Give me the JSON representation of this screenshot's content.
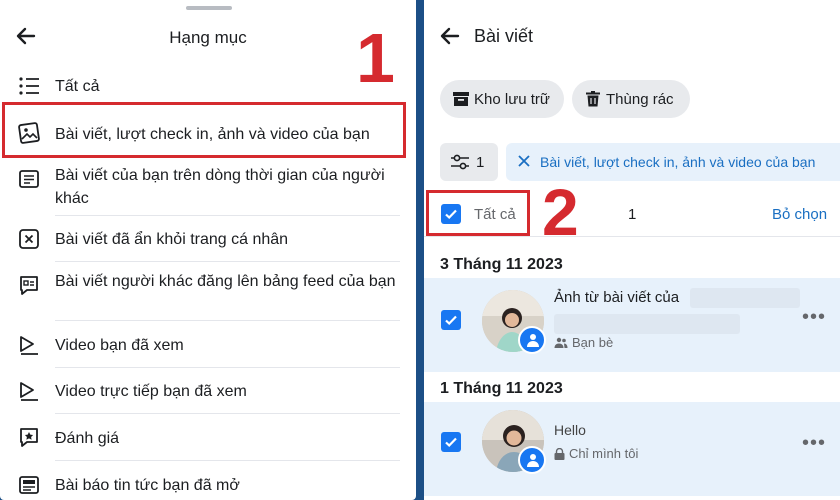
{
  "left_panel": {
    "header_title": "Hạng mục",
    "items": [
      {
        "label": "Tất cả",
        "icon": "list-icon"
      },
      {
        "label": "Bài viết, lượt check in, ảnh và video của bạn",
        "icon": "photo-icon"
      },
      {
        "label": "Bài viết của bạn trên dòng thời gian của người khác",
        "icon": "post-icon"
      },
      {
        "label": "Bài viết đã ẩn khỏi trang cá nhân",
        "icon": "hidden-post-icon"
      },
      {
        "label": "Bài viết người khác đăng lên bảng feed của bạn",
        "icon": "feed-post-icon"
      },
      {
        "label": "Video bạn đã xem",
        "icon": "video-icon"
      },
      {
        "label": "Video trực tiếp bạn đã xem",
        "icon": "live-video-icon"
      },
      {
        "label": "Đánh giá",
        "icon": "review-icon"
      },
      {
        "label": "Bài báo tin tức bạn đã mở",
        "icon": "news-icon"
      }
    ]
  },
  "right_panel": {
    "header_title": "Bài viết",
    "archive_label": "Kho lưu trữ",
    "trash_label": "Thùng rác",
    "filter_count": "1",
    "filter_label": "Bài viết, lượt check in, ảnh và video của bạn",
    "select_all_label": "Tất cả",
    "selected_count": "1",
    "deselect_label": "Bỏ chọn",
    "groups": [
      {
        "date": "3 Tháng 11 2023",
        "text": "Ảnh từ bài viết của",
        "audience": "Bạn bè"
      },
      {
        "date": "1 Tháng 11 2023",
        "text": "Hello",
        "audience": "Chỉ mình tôi"
      }
    ]
  },
  "annotations": {
    "step1": "1",
    "step2": "2"
  },
  "colors": {
    "accent": "#1877f2",
    "highlight": "#d52a2f",
    "background": "#1c4f86"
  }
}
